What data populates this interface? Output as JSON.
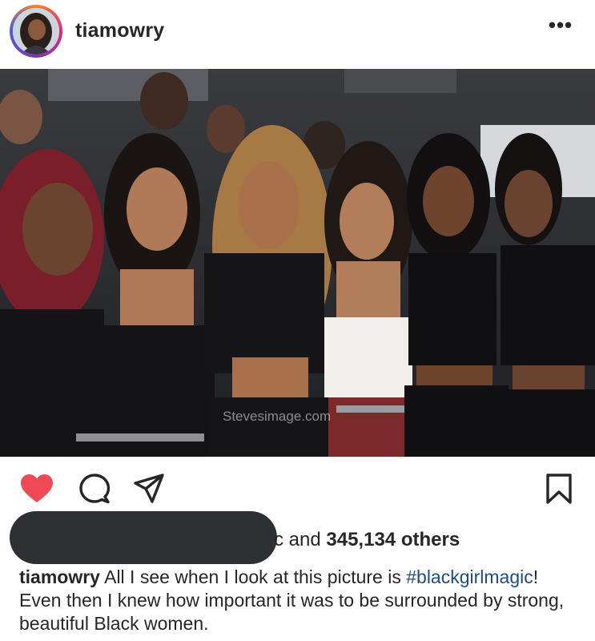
{
  "post": {
    "username": "tiamowry",
    "more_label": "•••",
    "photo": {
      "description_icon": "group-photo",
      "watermark": "Stevesimage.com"
    },
    "actions": {
      "like_icon": "heart-filled-icon",
      "like_color": "#ed4956",
      "comment_icon": "comment-icon",
      "share_icon": "share-icon",
      "save_icon": "bookmark-icon"
    },
    "likes": {
      "redacted_prefix": "c",
      "and_label": " and ",
      "count": "345,134 others"
    },
    "caption": {
      "user": "tiamowry",
      "text_before": " All I see when I look at this picture is ",
      "hashtag": "#blackgirlmagic",
      "text_after": "! Even then I knew how important it was to be  surrounded by strong, beautiful Black women."
    }
  }
}
